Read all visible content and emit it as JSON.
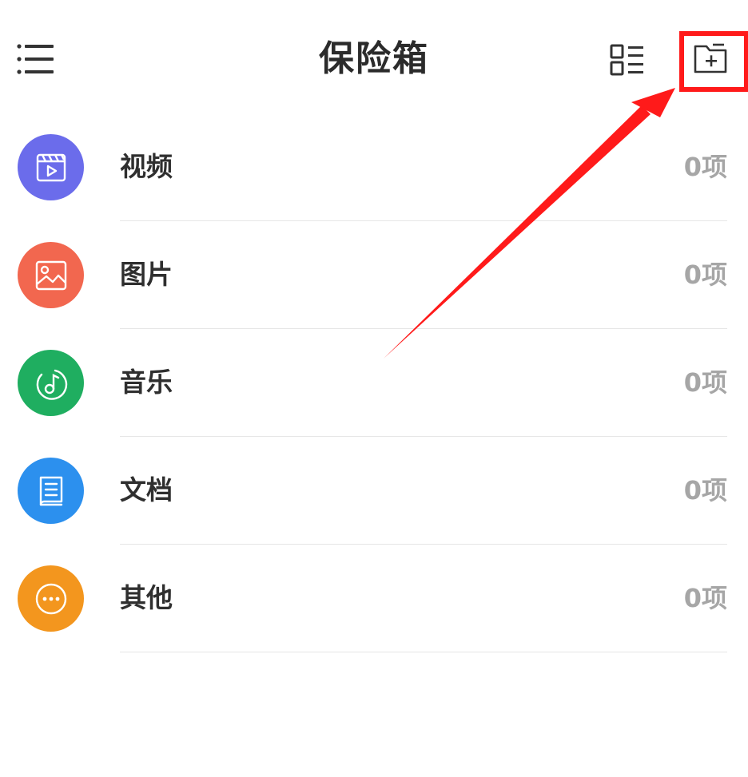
{
  "header": {
    "title": "保险箱",
    "menu_icon": "menu-icon",
    "view_icon": "list-view-icon",
    "add_icon": "add-folder-icon"
  },
  "categories": [
    {
      "label": "视频",
      "count": "0项",
      "icon": "video-icon",
      "color": "#6B6CEB"
    },
    {
      "label": "图片",
      "count": "0项",
      "icon": "image-icon",
      "color": "#F2674F"
    },
    {
      "label": "音乐",
      "count": "0项",
      "icon": "music-icon",
      "color": "#1FAE60"
    },
    {
      "label": "文档",
      "count": "0项",
      "icon": "document-icon",
      "color": "#2C90EE"
    },
    {
      "label": "其他",
      "count": "0项",
      "icon": "more-icon",
      "color": "#F3961E"
    }
  ],
  "annotation": {
    "color": "#FF1A1A"
  }
}
